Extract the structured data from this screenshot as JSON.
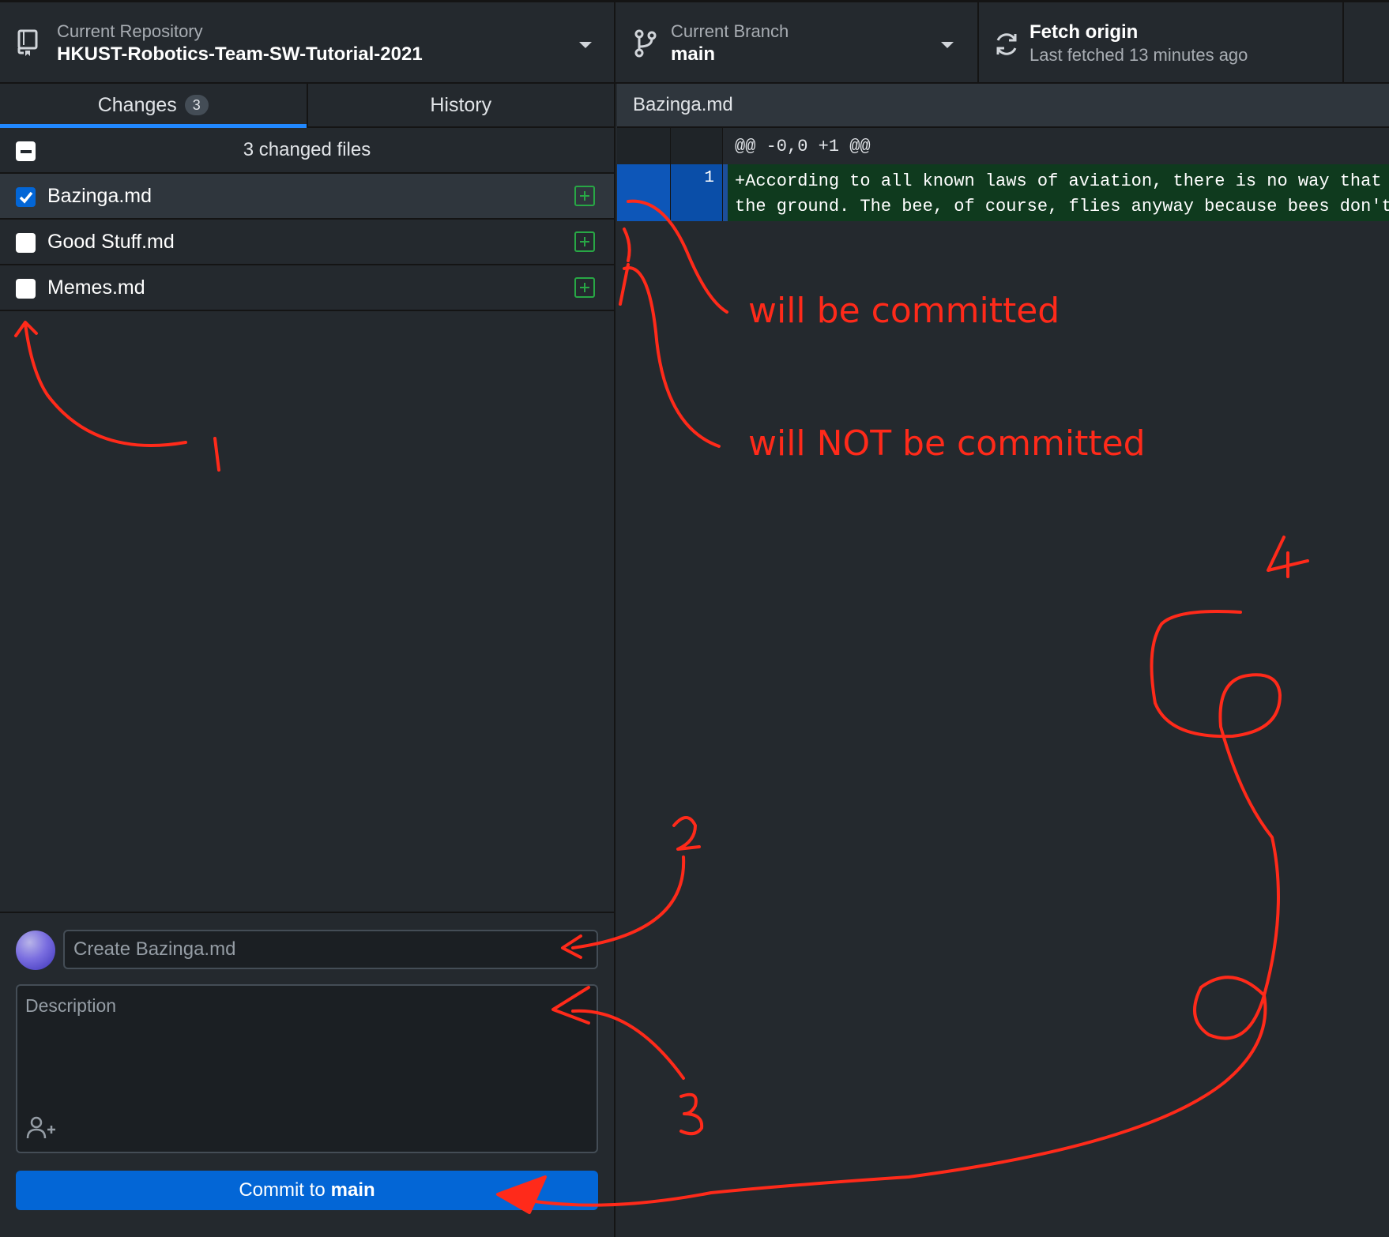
{
  "toolbar": {
    "repo_label": "Current Repository",
    "repo_name": "HKUST-Robotics-Team-SW-Tutorial-2021",
    "branch_label": "Current Branch",
    "branch_name": "main",
    "fetch_title": "Fetch origin",
    "fetch_subtitle": "Last fetched 13 minutes ago"
  },
  "tabs": {
    "changes_label": "Changes",
    "changes_count": "3",
    "history_label": "History"
  },
  "changes": {
    "header": "3 changed files",
    "files": [
      {
        "name": "Bazinga.md",
        "checked": true,
        "selected": true
      },
      {
        "name": "Good Stuff.md",
        "checked": false,
        "selected": false
      },
      {
        "name": "Memes.md",
        "checked": false,
        "selected": false
      }
    ]
  },
  "commit": {
    "summary_value": "",
    "summary_placeholder": "Create Bazinga.md",
    "description_placeholder": "Description",
    "button_prefix": "Commit to",
    "button_branch": "main"
  },
  "diff": {
    "file_name": "Bazinga.md",
    "hunk_header": "@@ -0,0 +1 @@",
    "line_number": "1",
    "line_1": "+According to all known laws of aviation, there is no way that",
    "line_2": "the ground. The bee, of course, flies anyway because bees don't"
  },
  "annotations": {
    "committed": "will be committed",
    "not_committed": "will NOT be committed",
    "step_1": "1",
    "step_2": "2",
    "step_3": "3",
    "step_4": "4",
    "color": "#ff2a1a"
  },
  "colors": {
    "accent": "#0366d6",
    "added": "#28a745",
    "background": "#24292e"
  }
}
